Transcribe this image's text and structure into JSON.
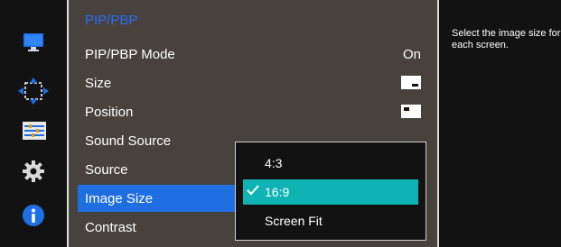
{
  "sidebar": {
    "icons": [
      "monitor-icon",
      "move-arrows-icon",
      "sliders-icon",
      "gear-icon",
      "info-icon"
    ]
  },
  "menu": {
    "title": "PIP/PBP",
    "items": [
      {
        "label": "PIP/PBP Mode",
        "value": "On"
      },
      {
        "label": "Size",
        "value_icon": "pip-size-icon"
      },
      {
        "label": "Position",
        "value_icon": "pip-position-icon"
      },
      {
        "label": "Sound Source"
      },
      {
        "label": "Source"
      },
      {
        "label": "Image Size",
        "selected": true
      },
      {
        "label": "Contrast"
      }
    ]
  },
  "dropdown": {
    "options": [
      {
        "label": "4:3"
      },
      {
        "label": "16:9",
        "selected": true
      },
      {
        "label": "Screen Fit"
      }
    ]
  },
  "help": {
    "text": "Select the image size for each screen."
  },
  "colors": {
    "menu_bg": "#47423d",
    "title_blue": "#2a6cf6",
    "selection_blue": "#1f6fe0",
    "selection_teal": "#0fb3b3",
    "icon_blue": "#1e6fe6"
  }
}
